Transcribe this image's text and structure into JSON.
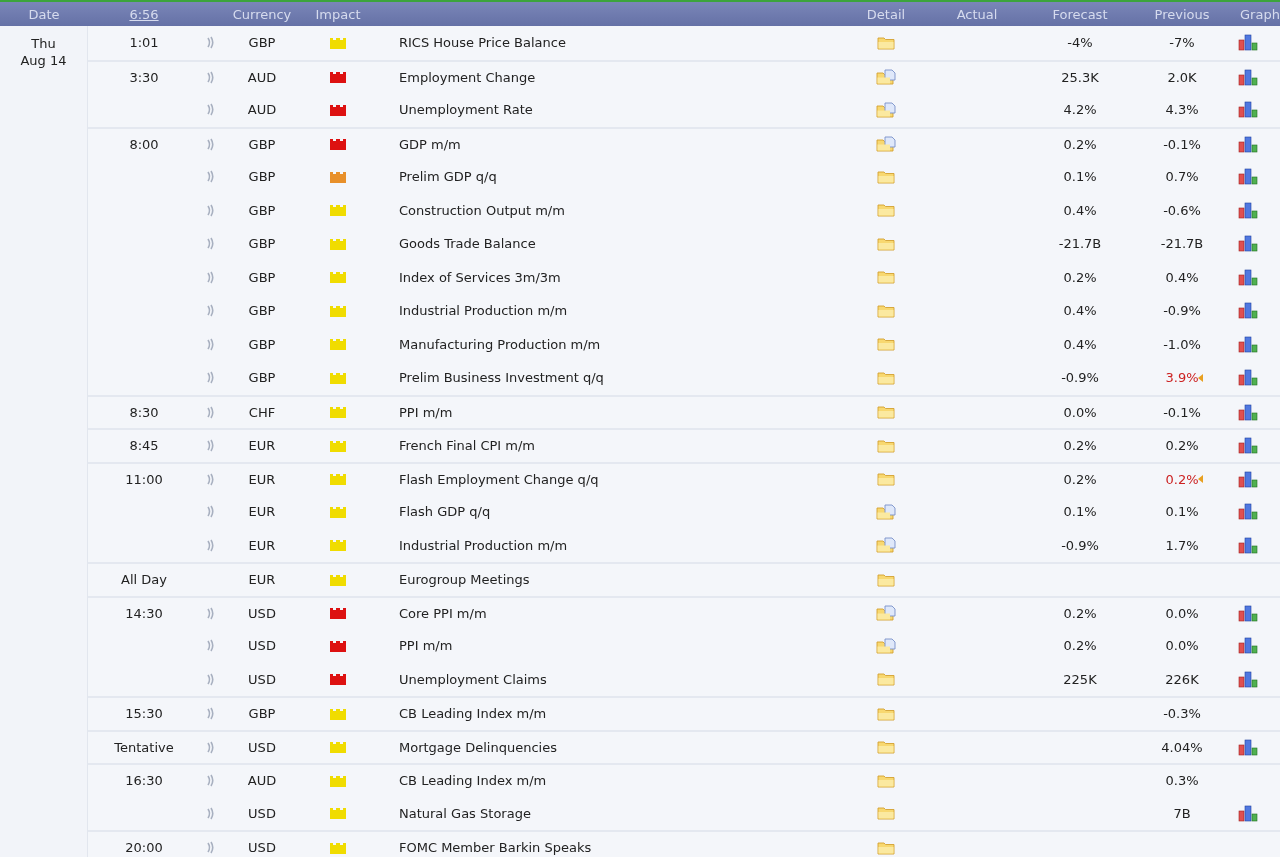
{
  "header": {
    "date": "Date",
    "clock": "6:56",
    "currency": "Currency",
    "impact": "Impact",
    "detail": "Detail",
    "actual": "Actual",
    "forecast": "Forecast",
    "previous": "Previous",
    "graph": "Graph"
  },
  "day": {
    "weekday": "Thu",
    "date": "Aug 14"
  },
  "rows": [
    {
      "time": "1:01",
      "alert": true,
      "currency": "GBP",
      "impact": {
        "color": "#f0dc00"
      },
      "event": "RICS House Price Balance",
      "has_document": false,
      "forecast": "-4%",
      "previous": "-7%",
      "revised": false,
      "graph": true
    },
    {
      "time": "3:30",
      "alert": true,
      "currency": "AUD",
      "impact": {
        "color": "#dd1111"
      },
      "event": "Employment Change",
      "has_document": true,
      "forecast": "25.3K",
      "previous": "2.0K",
      "revised": false,
      "graph": true
    },
    {
      "alert": true,
      "currency": "AUD",
      "impact": {
        "color": "#dd1111"
      },
      "event": "Unemployment Rate",
      "has_document": true,
      "forecast": "4.2%",
      "previous": "4.3%",
      "revised": false,
      "graph": true
    },
    {
      "time": "8:00",
      "alert": true,
      "currency": "GBP",
      "impact": {
        "color": "#dd1111"
      },
      "event": "GDP m/m",
      "has_document": true,
      "forecast": "0.2%",
      "previous": "-0.1%",
      "revised": false,
      "graph": true
    },
    {
      "alert": true,
      "currency": "GBP",
      "impact": {
        "color": "#e8902a"
      },
      "event": "Prelim GDP q/q",
      "has_document": false,
      "forecast": "0.1%",
      "previous": "0.7%",
      "revised": false,
      "graph": true
    },
    {
      "alert": true,
      "currency": "GBP",
      "impact": {
        "color": "#f0dc00"
      },
      "event": "Construction Output m/m",
      "has_document": false,
      "forecast": "0.4%",
      "previous": "-0.6%",
      "revised": false,
      "graph": true
    },
    {
      "alert": true,
      "currency": "GBP",
      "impact": {
        "color": "#f0dc00"
      },
      "event": "Goods Trade Balance",
      "has_document": false,
      "forecast": "-21.7B",
      "previous": "-21.7B",
      "revised": false,
      "graph": true
    },
    {
      "alert": true,
      "currency": "GBP",
      "impact": {
        "color": "#f0dc00"
      },
      "event": "Index of Services 3m/3m",
      "has_document": false,
      "forecast": "0.2%",
      "previous": "0.4%",
      "revised": false,
      "graph": true
    },
    {
      "alert": true,
      "currency": "GBP",
      "impact": {
        "color": "#f0dc00"
      },
      "event": "Industrial Production m/m",
      "has_document": false,
      "forecast": "0.4%",
      "previous": "-0.9%",
      "revised": false,
      "graph": true
    },
    {
      "alert": true,
      "currency": "GBP",
      "impact": {
        "color": "#f0dc00"
      },
      "event": "Manufacturing Production m/m",
      "has_document": false,
      "forecast": "0.4%",
      "previous": "-1.0%",
      "revised": false,
      "graph": true
    },
    {
      "alert": true,
      "currency": "GBP",
      "impact": {
        "color": "#f0dc00"
      },
      "event": "Prelim Business Investment q/q",
      "has_document": false,
      "forecast": "-0.9%",
      "previous": "3.9%",
      "revised": true,
      "graph": true
    },
    {
      "time": "8:30",
      "alert": true,
      "currency": "CHF",
      "impact": {
        "color": "#f0dc00"
      },
      "event": "PPI m/m",
      "has_document": false,
      "forecast": "0.0%",
      "previous": "-0.1%",
      "revised": false,
      "graph": true
    },
    {
      "time": "8:45",
      "alert": true,
      "currency": "EUR",
      "impact": {
        "color": "#f0dc00"
      },
      "event": "French Final CPI m/m",
      "has_document": false,
      "forecast": "0.2%",
      "previous": "0.2%",
      "revised": false,
      "graph": true
    },
    {
      "time": "11:00",
      "alert": true,
      "currency": "EUR",
      "impact": {
        "color": "#f0dc00"
      },
      "event": "Flash Employment Change q/q",
      "has_document": false,
      "forecast": "0.2%",
      "previous": "0.2%",
      "revised": true,
      "graph": true
    },
    {
      "alert": true,
      "currency": "EUR",
      "impact": {
        "color": "#f0dc00"
      },
      "event": "Flash GDP q/q",
      "has_document": true,
      "forecast": "0.1%",
      "previous": "0.1%",
      "revised": false,
      "graph": true
    },
    {
      "alert": true,
      "currency": "EUR",
      "impact": {
        "color": "#f0dc00"
      },
      "event": "Industrial Production m/m",
      "has_document": true,
      "forecast": "-0.9%",
      "previous": "1.7%",
      "revised": false,
      "graph": true
    },
    {
      "time": "All Day",
      "alert": false,
      "currency": "EUR",
      "impact": {
        "color": "#f0dc00"
      },
      "event": "Eurogroup Meetings",
      "has_document": false,
      "revised": false,
      "graph": false
    },
    {
      "time": "14:30",
      "alert": true,
      "currency": "USD",
      "impact": {
        "color": "#dd1111"
      },
      "event": "Core PPI m/m",
      "has_document": true,
      "forecast": "0.2%",
      "previous": "0.0%",
      "revised": false,
      "graph": true
    },
    {
      "alert": true,
      "currency": "USD",
      "impact": {
        "color": "#dd1111"
      },
      "event": "PPI m/m",
      "has_document": true,
      "forecast": "0.2%",
      "previous": "0.0%",
      "revised": false,
      "graph": true
    },
    {
      "alert": true,
      "currency": "USD",
      "impact": {
        "color": "#dd1111"
      },
      "event": "Unemployment Claims",
      "has_document": false,
      "forecast": "225K",
      "previous": "226K",
      "revised": false,
      "graph": true
    },
    {
      "time": "15:30",
      "alert": true,
      "currency": "GBP",
      "impact": {
        "color": "#f0dc00"
      },
      "event": "CB Leading Index m/m",
      "has_document": false,
      "previous": "-0.3%",
      "revised": false,
      "graph": false
    },
    {
      "time": "Tentative",
      "alert": true,
      "currency": "USD",
      "impact": {
        "color": "#f0dc00"
      },
      "event": "Mortgage Delinquencies",
      "has_document": false,
      "previous": "4.04%",
      "revised": false,
      "graph": true
    },
    {
      "time": "16:30",
      "alert": true,
      "currency": "AUD",
      "impact": {
        "color": "#f0dc00"
      },
      "event": "CB Leading Index m/m",
      "has_document": false,
      "previous": "0.3%",
      "revised": false,
      "graph": false
    },
    {
      "alert": true,
      "currency": "USD",
      "impact": {
        "color": "#f0dc00"
      },
      "event": "Natural Gas Storage",
      "has_document": false,
      "previous": "7B",
      "revised": false,
      "graph": true
    },
    {
      "time": "20:00",
      "alert": true,
      "currency": "USD",
      "impact": {
        "color": "#f0dc00"
      },
      "event": "FOMC Member Barkin Speaks",
      "has_document": false,
      "revised": false,
      "graph": false
    }
  ]
}
